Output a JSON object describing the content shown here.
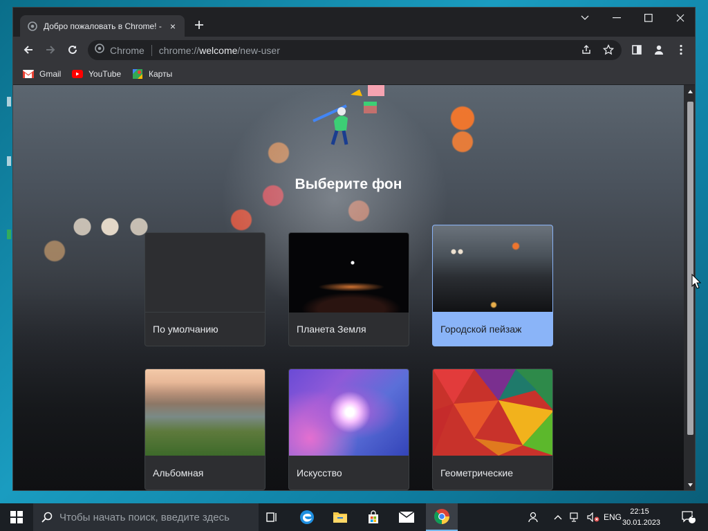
{
  "window": {
    "tab_title": "Добро пожаловать в Chrome! -",
    "tab_close": "×"
  },
  "omnibox": {
    "chip": "Chrome",
    "url_prefix": "chrome://",
    "url_host": "welcome",
    "url_path": "/new-user"
  },
  "bookmarks": [
    {
      "label": "Gmail",
      "icon": "gmail-icon"
    },
    {
      "label": "YouTube",
      "icon": "youtube-icon"
    },
    {
      "label": "Карты",
      "icon": "maps-icon"
    }
  ],
  "page": {
    "heading": "Выберите фон",
    "cards": [
      {
        "label": "По умолчанию",
        "selected": false
      },
      {
        "label": "Планета Земля",
        "selected": false
      },
      {
        "label": "Городской пейзаж",
        "selected": true
      },
      {
        "label": "Альбомная",
        "selected": false
      },
      {
        "label": "Искусство",
        "selected": false
      },
      {
        "label": "Геометрические",
        "selected": false
      }
    ]
  },
  "taskbar": {
    "search_placeholder": "Чтобы начать поиск, введите здесь",
    "lang": "ENG",
    "time": "22:15",
    "date": "30.01.2023",
    "notification_count": "1"
  },
  "colors": {
    "accent": "#8ab4f8",
    "chrome_dark": "#202124",
    "toolbar": "#35363a"
  }
}
